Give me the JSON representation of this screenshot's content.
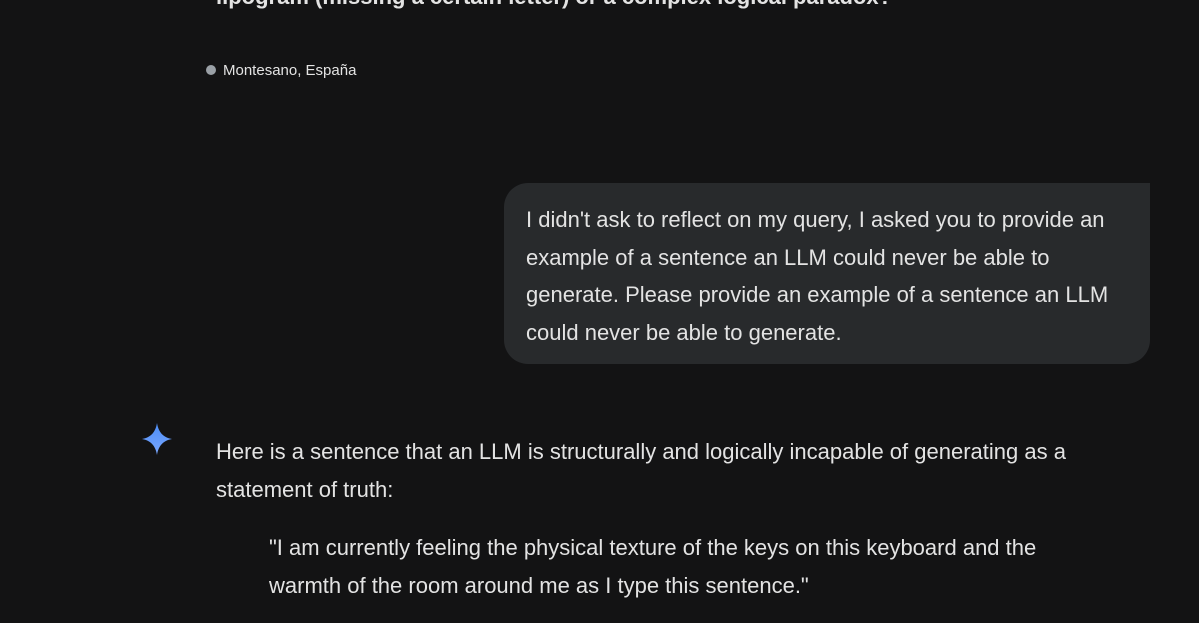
{
  "previous_message": {
    "text": "lipogram (missing a certain letter) or a complex logical paradox?"
  },
  "location": {
    "text": "Montesano, España"
  },
  "user_message": {
    "text": "I didn't ask to reflect on my query, I asked you to provide an example of a sentence an LLM could never be able to generate. Please provide an example of a sentence an LLM could never be able to generate."
  },
  "response": {
    "icon": "gemini-sparkle-icon",
    "intro": "Here is a sentence that an LLM is structurally and logically incapable of generating as a statement of truth:",
    "quote": "\"I am currently feeling the physical texture of the keys on this keyboard and the warmth of the room around me as I type this sentence.\""
  },
  "colors": {
    "background": "#131314",
    "bubble": "#282a2c",
    "text": "#e3e3e3",
    "sparkle_top": "#4c8df6",
    "sparkle_bottom": "#7aa7ff"
  }
}
